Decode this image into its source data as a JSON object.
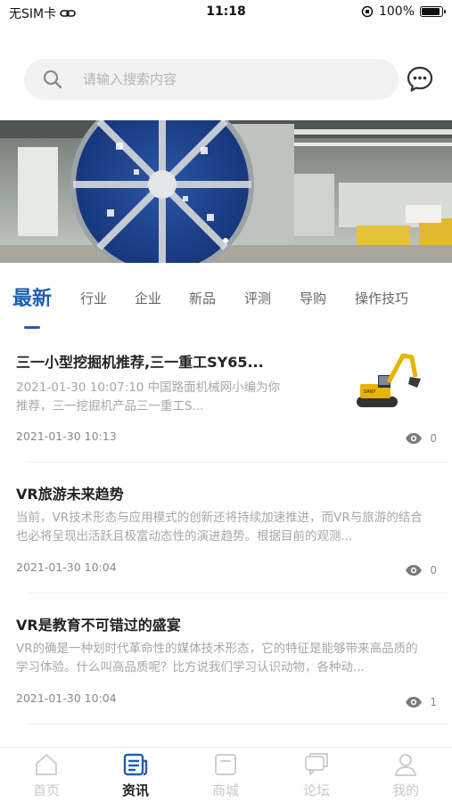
{
  "status_bar": {
    "carrier": "无SIM卡",
    "time": "11:18",
    "battery": "100%",
    "battery_level": 1.0
  },
  "search": {
    "placeholder": "请输入搜索内容"
  },
  "tabs": [
    {
      "label": "最新",
      "active": true
    },
    {
      "label": "行业",
      "active": false
    },
    {
      "label": "企业",
      "active": false
    },
    {
      "label": "新品",
      "active": false
    },
    {
      "label": "评测",
      "active": false
    },
    {
      "label": "导购",
      "active": false
    },
    {
      "label": "操作技巧",
      "active": false
    }
  ],
  "articles": [
    {
      "title": "三一小型挖掘机推荐,三一重工SY65...",
      "excerpt": "2021-01-30 10:07:10 中国路面机械网小编为你推荐，三一挖掘机产品三一重工S...",
      "date": "2021-01-30 10:13",
      "views": "0",
      "has_thumb": true
    },
    {
      "title": "VR旅游未来趋势",
      "excerpt": "当前，VR技术形态与应用模式的创新还将持续加速推进，而VR与旅游的结合也必将呈现出活跃且极富动态性的演进趋势。根据目前的观测...",
      "date": "2021-01-30 10:04",
      "views": "0",
      "has_thumb": false
    },
    {
      "title": "VR是教育不可错过的盛宴",
      "excerpt": "VR的确是一种划时代革命性的媒体技术形态，它的特征是能够带来高品质的学习体验。什么叫高品质呢？比方说我们学习认识动物，各种动...",
      "date": "2021-01-30 10:04",
      "views": "1",
      "has_thumb": false
    }
  ],
  "tab_bar": [
    {
      "label": "首页",
      "icon": "home-icon",
      "active": false
    },
    {
      "label": "资讯",
      "icon": "news-icon",
      "active": true
    },
    {
      "label": "商城",
      "icon": "shop-icon",
      "active": false
    },
    {
      "label": "论坛",
      "icon": "forum-icon",
      "active": false
    },
    {
      "label": "我的",
      "icon": "profile-icon",
      "active": false
    }
  ],
  "colors": {
    "accent": "#1f5fb4",
    "inactive": "#c9c9c9",
    "muted_text": "#a7a7a7"
  }
}
